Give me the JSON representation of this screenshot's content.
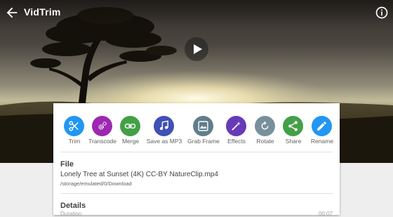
{
  "app_bar": {
    "title": "VidTrim",
    "back_icon": "arrow-back-icon",
    "info_icon": "info-icon"
  },
  "player": {
    "play_icon": "play-icon"
  },
  "actions": [
    {
      "label": "Trim",
      "icon": "scissors-icon",
      "color": "#2196F3"
    },
    {
      "label": "Transcode",
      "icon": "gears-icon",
      "color": "#9C27B0"
    },
    {
      "label": "Merge",
      "icon": "link-icon",
      "color": "#43A047"
    },
    {
      "label": "Save as MP3",
      "icon": "music-icon",
      "color": "#3F51B5"
    },
    {
      "label": "Grab Frame",
      "icon": "image-icon",
      "color": "#607D8B"
    },
    {
      "label": "Effects",
      "icon": "magic-wand-icon",
      "color": "#673AB7"
    },
    {
      "label": "Rotate",
      "icon": "rotate-icon",
      "color": "#78909C"
    },
    {
      "label": "Share",
      "icon": "share-icon",
      "color": "#43A047"
    },
    {
      "label": "Rename",
      "icon": "pencil-icon",
      "color": "#2196F3"
    }
  ],
  "file": {
    "heading": "File",
    "name": "Lonely Tree at Sunset (4K) CC-BY NatureClip.mp4",
    "path": "/storage/emulated/0/Download"
  },
  "details": {
    "heading": "Details",
    "duration_label": "Duration",
    "duration_value": "00:07"
  }
}
